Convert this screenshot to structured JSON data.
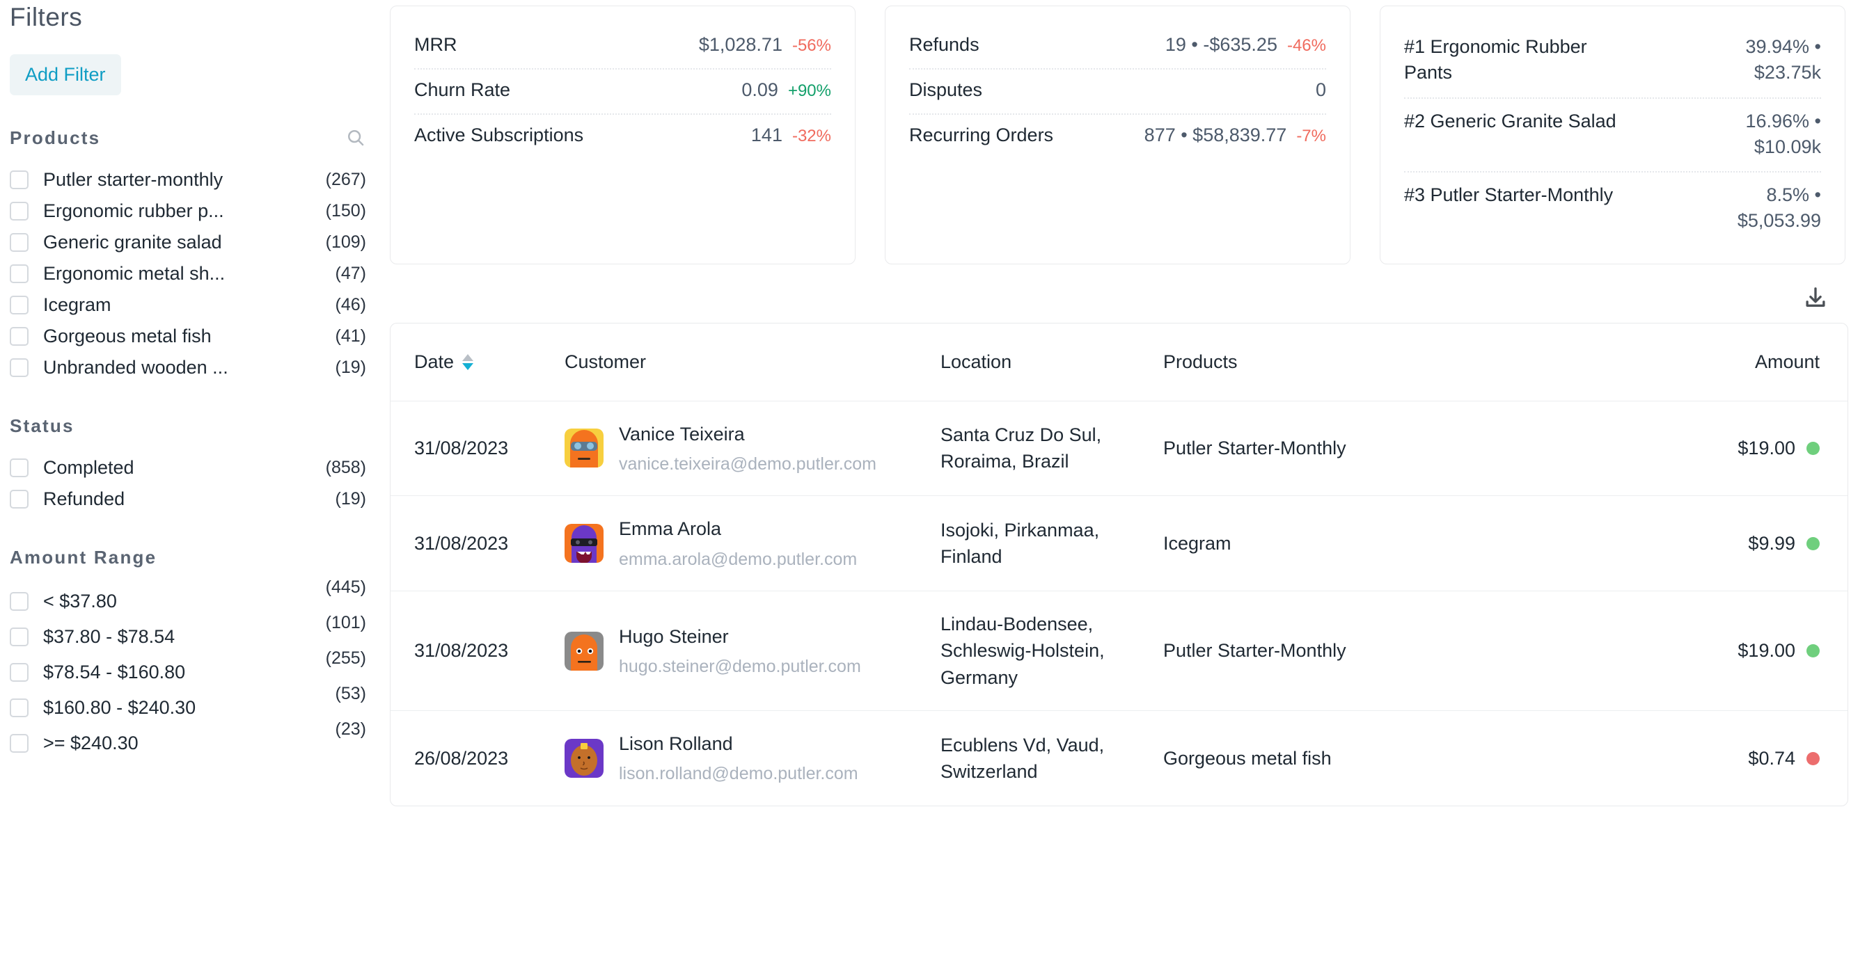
{
  "sidebar": {
    "title": "Filters",
    "add_filter_label": "Add Filter",
    "search_icon": "search-icon",
    "facets": [
      {
        "title": "Products",
        "has_search": true,
        "items": [
          {
            "label": "Putler starter-monthly",
            "count": "(267)"
          },
          {
            "label": "Ergonomic rubber p...",
            "count": "(150)"
          },
          {
            "label": "Generic granite salad",
            "count": "(109)"
          },
          {
            "label": "Ergonomic metal sh...",
            "count": "(47)"
          },
          {
            "label": "Icegram",
            "count": "(46)"
          },
          {
            "label": "Gorgeous metal fish",
            "count": "(41)"
          },
          {
            "label": "Unbranded wooden ...",
            "count": "(19)"
          }
        ]
      },
      {
        "title": "Status",
        "has_search": false,
        "items": [
          {
            "label": "Completed",
            "count": "(858)"
          },
          {
            "label": "Refunded",
            "count": "(19)"
          }
        ]
      },
      {
        "title": "Amount Range",
        "has_search": false,
        "stacked_counts": true,
        "items": [
          {
            "label": "< $37.80",
            "count": "(445)"
          },
          {
            "label": "$37.80 - $78.54",
            "count": "(101)"
          },
          {
            "label": "$78.54 - $160.80",
            "count": "(255)"
          },
          {
            "label": "$160.80 - $240.30",
            "count": "(53)"
          },
          {
            "label": ">= $240.30",
            "count": "(23)"
          }
        ]
      }
    ]
  },
  "cards": {
    "kpi_left": [
      {
        "label": "MRR",
        "value": "$1,028.71",
        "delta": "-56%",
        "dir": "neg"
      },
      {
        "label": "Churn Rate",
        "value": "0.09",
        "delta": "+90%",
        "dir": "pos"
      },
      {
        "label": "Active Subscriptions",
        "value": "141",
        "delta": "-32%",
        "dir": "neg"
      }
    ],
    "kpi_mid": [
      {
        "label": "Refunds",
        "value": "19 • -$635.25",
        "delta": "-46%",
        "dir": "neg"
      },
      {
        "label": "Disputes",
        "value": "0",
        "delta": "",
        "dir": "none"
      },
      {
        "label": "Recurring Orders",
        "value": "877 • $58,839.77",
        "delta": "-7%",
        "dir": "neg"
      }
    ],
    "top_products": [
      {
        "name": "#1 Ergonomic Rubber Pants",
        "percent": "39.94% •",
        "revenue": "$23.75k"
      },
      {
        "name": "#2 Generic Granite Salad",
        "percent": "16.96% •",
        "revenue": "$10.09k"
      },
      {
        "name": "#3 Putler Starter-Monthly",
        "percent": "8.5% •",
        "revenue": "$5,053.99"
      }
    ]
  },
  "toolbar": {
    "download_icon": "download-icon"
  },
  "table": {
    "columns": [
      "Date",
      "Customer",
      "Location",
      "Products",
      "Amount"
    ],
    "sort": {
      "column": "Date",
      "direction": "desc"
    },
    "rows": [
      {
        "date": "31/08/2023",
        "name": "Vanice Teixeira",
        "email": "vanice.teixeira@demo.putler.com",
        "location": "Santa Cruz Do Sul, Roraima, Brazil",
        "product": "Putler Starter-Monthly",
        "amount": "$19.00",
        "status_color": "#6fcf7d",
        "avatar": "orange-sunglasses-avatar"
      },
      {
        "date": "31/08/2023",
        "name": "Emma Arola",
        "email": "emma.arola@demo.putler.com",
        "location": "Isojoki, Pirkanmaa, Finland",
        "product": "Icegram",
        "amount": "$9.99",
        "status_color": "#6fcf7d",
        "avatar": "purple-monster-avatar"
      },
      {
        "date": "31/08/2023",
        "name": "Hugo Steiner",
        "email": "hugo.steiner@demo.putler.com",
        "location": "Lindau-Bodensee, Schleswig-Holstein, Germany",
        "product": "Putler Starter-Monthly",
        "amount": "$19.00",
        "status_color": "#6fcf7d",
        "avatar": "orange-gray-avatar"
      },
      {
        "date": "26/08/2023",
        "name": "Lison Rolland",
        "email": "lison.rolland@demo.putler.com",
        "location": "Ecublens Vd, Vaud, Switzerland",
        "product": "Gorgeous metal fish",
        "amount": "$0.74",
        "status_color": "#ec6d6d",
        "avatar": "purple-brown-avatar"
      }
    ]
  },
  "colors": {
    "accent": "#0f9dc4",
    "positive": "#14a06b",
    "negative": "#f06b5e",
    "sort_active": "#15b0d4"
  }
}
